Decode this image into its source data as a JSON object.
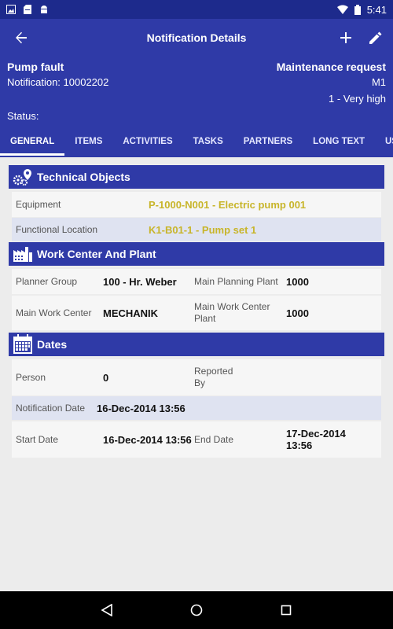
{
  "status_bar": {
    "time": "5:41"
  },
  "toolbar": {
    "title": "Notification Details"
  },
  "notification": {
    "title": "Pump fault",
    "number": "Notification: 10002202",
    "type": "Maintenance request",
    "code": "M1",
    "priority": "1 - Very high",
    "status_label": "Status:"
  },
  "tabs": [
    {
      "label": "GENERAL"
    },
    {
      "label": "ITEMS"
    },
    {
      "label": "ACTIVITIES"
    },
    {
      "label": "TASKS"
    },
    {
      "label": "PARTNERS"
    },
    {
      "label": "LONG TEXT"
    },
    {
      "label": "USER ST"
    }
  ],
  "technical_objects": {
    "title": "Technical Objects",
    "equipment_label": "Equipment",
    "equipment_value": "P-1000-N001 - Electric pump 001",
    "functional_location_label": "Functional Location",
    "functional_location_value": "K1-B01-1 - Pump set 1"
  },
  "work_center": {
    "title": "Work Center And Plant",
    "planner_group_label": "Planner Group",
    "planner_group_value": "100 - Hr. Weber",
    "main_planning_plant_label": "Main Planning Plant",
    "main_planning_plant_value": "1000",
    "main_work_center_label": "Main Work Center",
    "main_work_center_value": "MECHANIK",
    "main_work_center_plant_label": "Main Work Center Plant",
    "main_work_center_plant_value": "1000"
  },
  "dates": {
    "title": "Dates",
    "person_label": "Person",
    "person_value": "0",
    "reported_by_label": "Reported By",
    "notification_date_label": "Notification Date",
    "notification_date_value": "16-Dec-2014 13:56",
    "start_date_label": "Start Date",
    "start_date_value": "16-Dec-2014 13:56",
    "end_date_label": "End Date",
    "end_date_value": "17-Dec-2014 13:56"
  },
  "colors": {
    "header": "#2f3aa7",
    "status_bar": "#1d2a8c",
    "link": "#c8b52a",
    "row_alt": "#dfe3f1"
  }
}
